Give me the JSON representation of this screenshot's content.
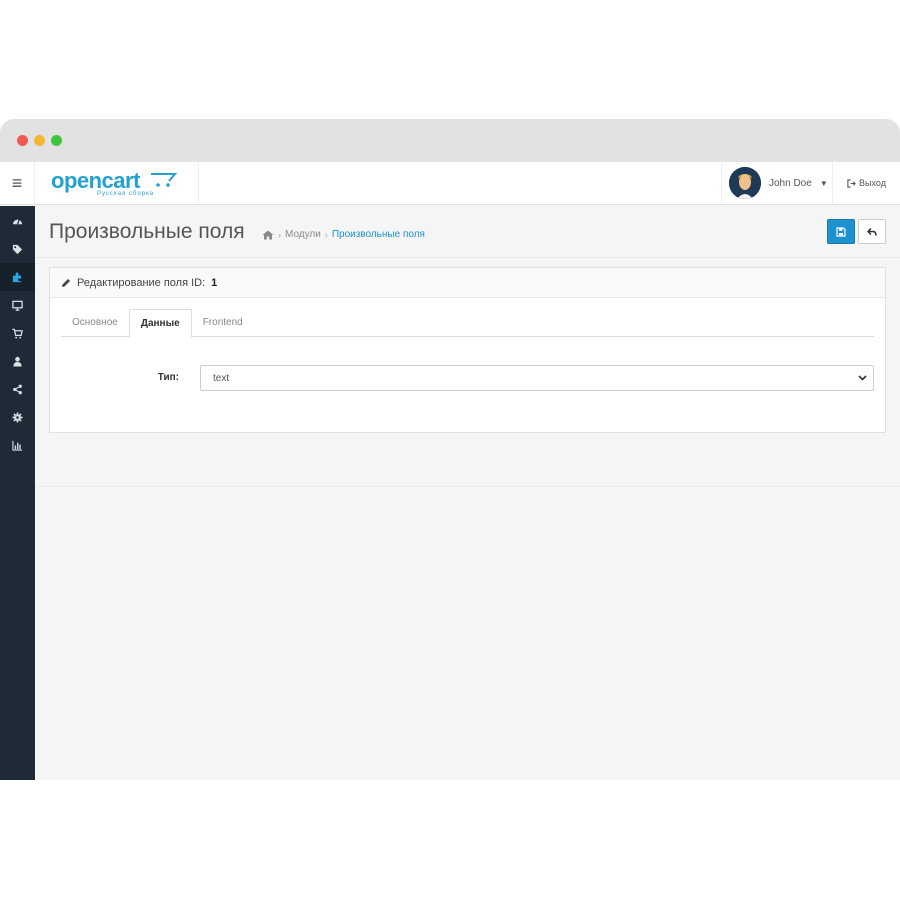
{
  "header": {
    "logo_text": "opencart",
    "logo_sub": "Русская сборка",
    "user_name": "John Doe",
    "logout_label": "Выход"
  },
  "sidebar": {
    "items": [
      {
        "icon": "dashboard-icon",
        "active": false
      },
      {
        "icon": "tags-icon",
        "active": false
      },
      {
        "icon": "puzzle-icon",
        "active": true
      },
      {
        "icon": "desktop-icon",
        "active": false
      },
      {
        "icon": "cart-icon",
        "active": false
      },
      {
        "icon": "user-icon",
        "active": false
      },
      {
        "icon": "share-icon",
        "active": false
      },
      {
        "icon": "cog-icon",
        "active": false
      },
      {
        "icon": "bar-chart-icon",
        "active": false
      }
    ]
  },
  "page": {
    "title": "Произвольные поля",
    "breadcrumb": [
      "Модули",
      "Произвольные поля"
    ]
  },
  "panel": {
    "heading_prefix": "Редактирование поля ID:",
    "heading_id": "1",
    "tabs": [
      "Основное",
      "Данные",
      "Frontend"
    ],
    "active_tab": "Данные",
    "field_label": "Тип:",
    "field_value": "text"
  },
  "colors": {
    "accent": "#1e91cf",
    "sidebar_bg": "#1e2a36",
    "logo": "#23a1d1"
  }
}
